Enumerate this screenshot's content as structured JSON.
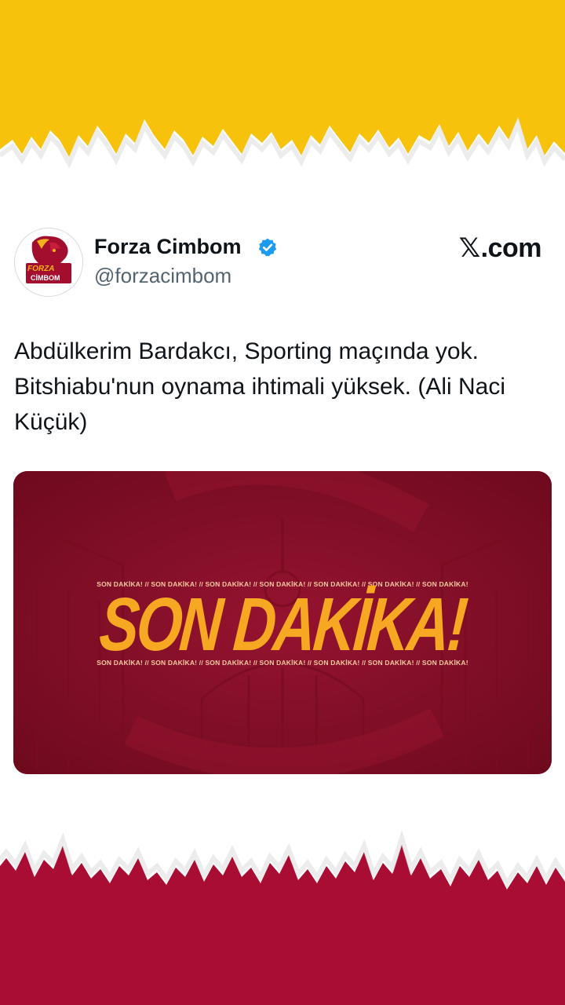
{
  "colors": {
    "top_band": "#f6c20b",
    "bottom_band": "#a90d33",
    "media_background": "#8e0f27",
    "headline_orange": "#f7a823",
    "verified_blue": "#1d9bf0"
  },
  "tweet": {
    "display_name": "Forza Cimbom",
    "handle": "@forzacimbom",
    "verified": true,
    "verified_icon": "verified-badge-icon",
    "site_mark_x": "𝕏",
    "site_mark_rest": ".com",
    "text": "Abdülkerim Bardakcı, Sporting maçında yok. Bitshiabu'nun oynama ihtimali yüksek. (Ali Naci Küçük)"
  },
  "avatar": {
    "icon": "lion-logo-icon",
    "line1": "FORZA",
    "line2": "CİMBOM"
  },
  "media": {
    "headline": "SON DAKİKA!",
    "ticker_top": "SON DAKİKA! // SON DAKİKA! // SON DAKİKA! // SON DAKİKA! // SON DAKİKA! // SON DAKİKA! // SON DAKİKA!",
    "ticker_bottom": "SON DAKİKA! // SON DAKİKA! // SON DAKİKA! // SON DAKİKA! // SON DAKİKA! // SON DAKİKA! // SON DAKİKA!"
  }
}
